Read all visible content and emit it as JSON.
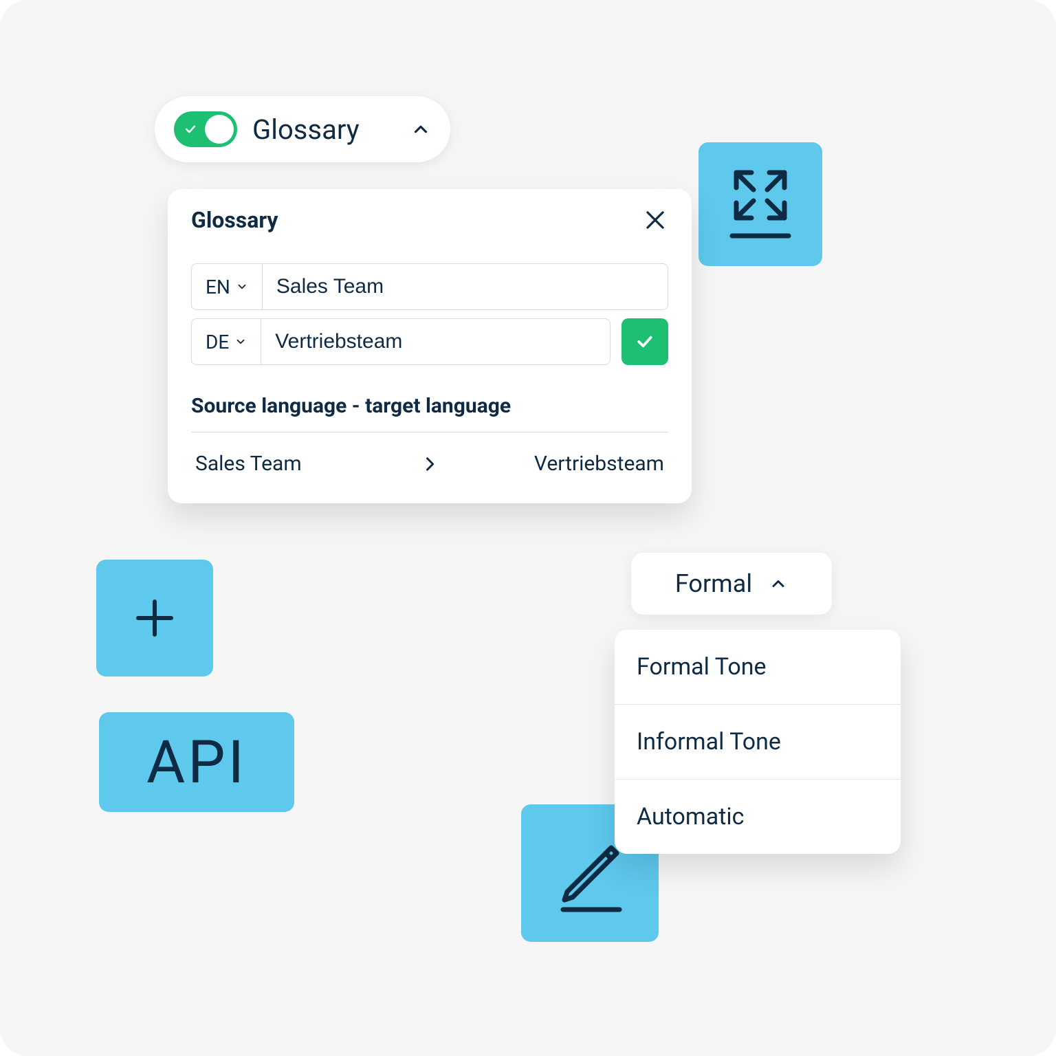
{
  "glossary_toggle": {
    "label": "Glossary",
    "enabled": true
  },
  "glossary_panel": {
    "title": "Glossary",
    "source": {
      "lang": "EN",
      "term": "Sales Team"
    },
    "target": {
      "lang": "DE",
      "term": "Vertriebsteam"
    },
    "mapping_heading": "Source language - target language",
    "mapping": {
      "source": "Sales Team",
      "target": "Vertriebsteam"
    }
  },
  "tone": {
    "selected": "Formal",
    "options": [
      "Formal Tone",
      "Informal Tone",
      "Automatic"
    ]
  },
  "tiles": {
    "api": "API"
  }
}
